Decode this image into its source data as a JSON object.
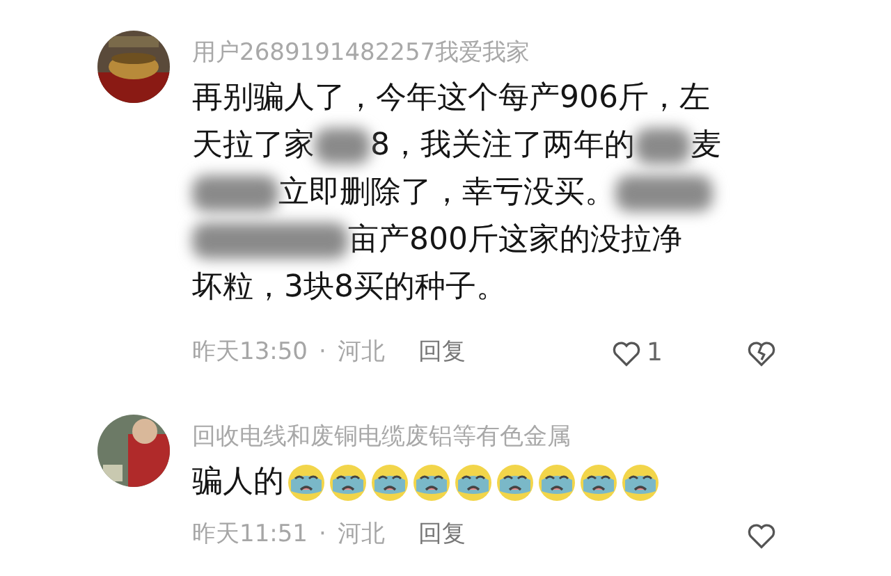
{
  "comments": [
    {
      "avatar": {
        "kind": "picture"
      },
      "username": "用户2689191482257我爱我家",
      "lines": [
        [
          {
            "kind": "text",
            "text": "再别骗人了，今年这个每产906斤，左"
          }
        ],
        [
          {
            "kind": "text",
            "text": "天拉了家"
          },
          {
            "kind": "redacted"
          },
          {
            "kind": "text",
            "text": "8，我关注了两年的"
          },
          {
            "kind": "redacted"
          },
          {
            "kind": "text",
            "text": "麦"
          }
        ],
        [
          {
            "kind": "redacted"
          },
          {
            "kind": "text",
            "text": "立即删除了，幸亏没买。"
          },
          {
            "kind": "redacted"
          }
        ],
        [
          {
            "kind": "redacted"
          },
          {
            "kind": "text",
            "text": "亩产800斤这家的没拉净"
          }
        ],
        [
          {
            "kind": "text",
            "text": "坏粒，3块8买的种子。"
          }
        ]
      ],
      "time": "昨天13:50",
      "separator": "·",
      "location": "河北",
      "reply": "回复",
      "like": {
        "liked": false,
        "count": "1"
      },
      "dislike": {
        "selected": false
      }
    },
    {
      "avatar": {
        "kind": "picture"
      },
      "username": "回收电线和废铜电缆废铝等有色金属",
      "lines": [
        [
          {
            "kind": "text",
            "text": "骗人的"
          }
        ]
      ],
      "emojis": [
        {
          "kind": "crying"
        },
        {
          "kind": "crying"
        },
        {
          "kind": "crying"
        },
        {
          "kind": "crying"
        },
        {
          "kind": "crying"
        },
        {
          "kind": "crying"
        },
        {
          "kind": "crying"
        },
        {
          "kind": "crying"
        },
        {
          "kind": "crying"
        }
      ],
      "time": "昨天11:51",
      "separator": "·",
      "location": "河北",
      "reply": "回复",
      "like": {
        "liked": false
      }
    }
  ]
}
